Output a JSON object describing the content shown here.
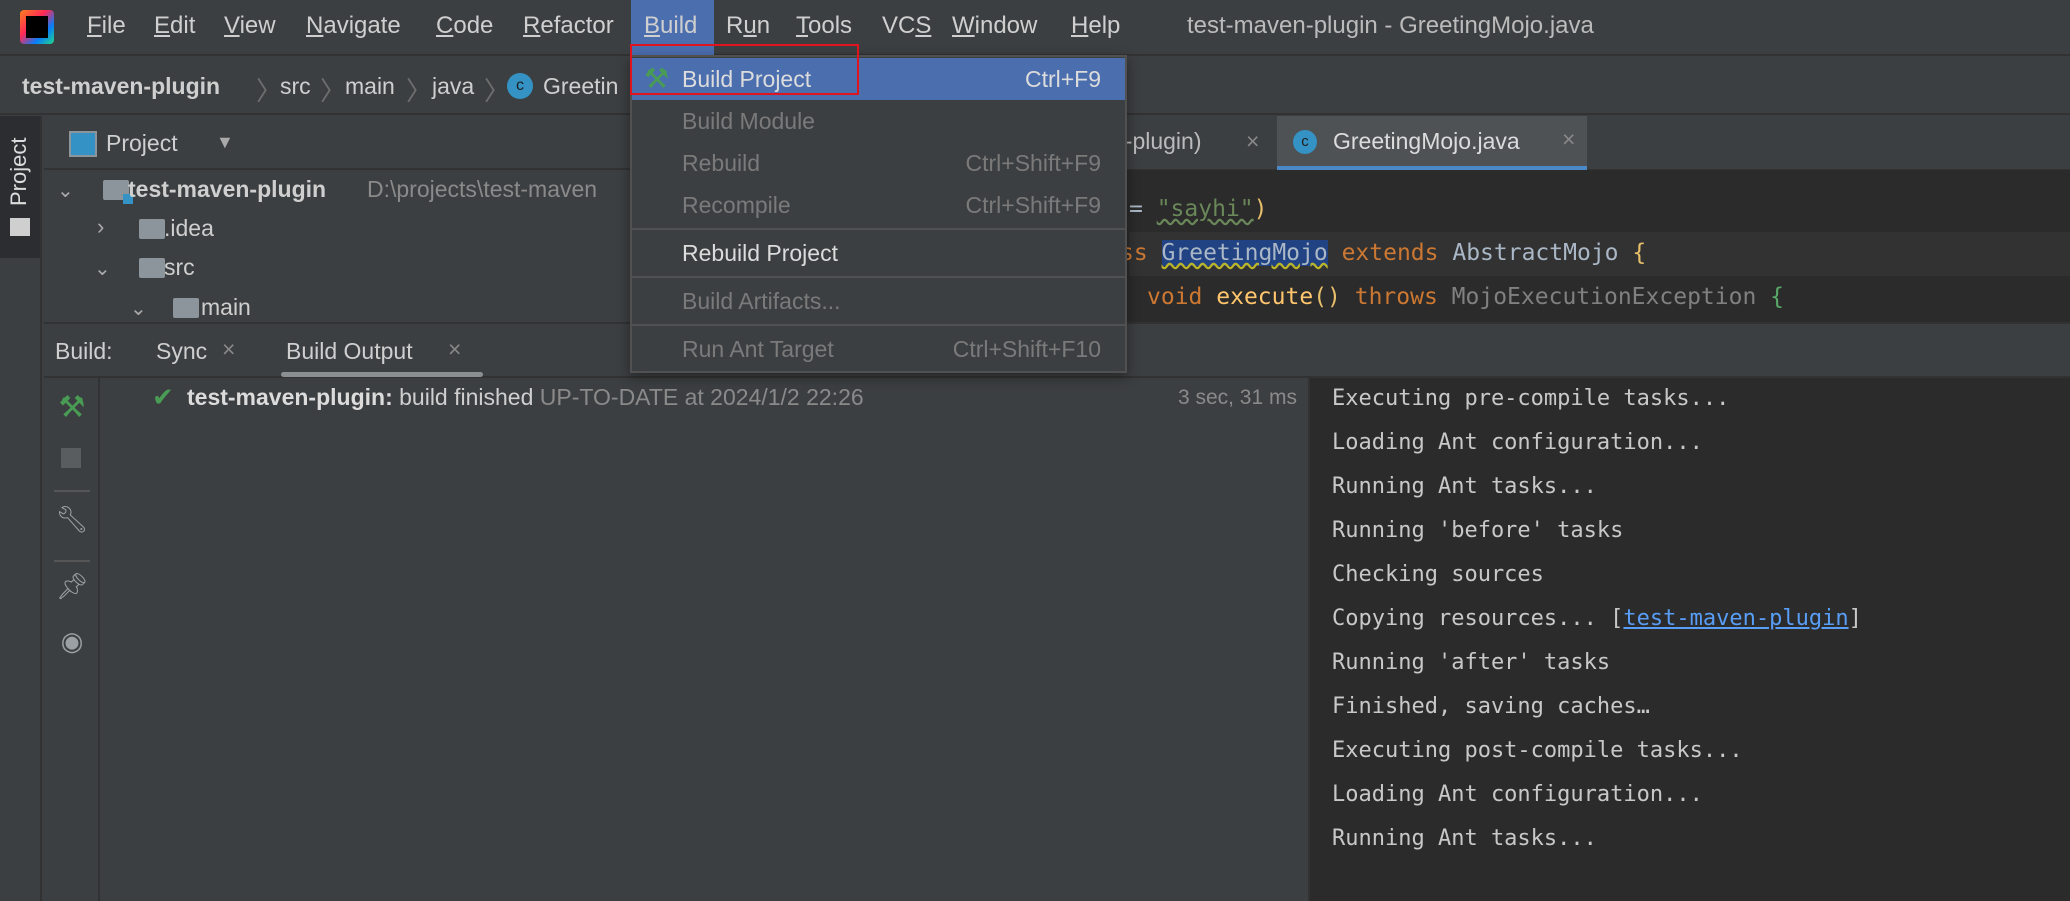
{
  "window": {
    "title": "test-maven-plugin - GreetingMojo.java",
    "logo": "intellij-idea-logo"
  },
  "menubar": {
    "items": [
      {
        "label": "File",
        "mnemonic": "F"
      },
      {
        "label": "Edit",
        "mnemonic": "E"
      },
      {
        "label": "View",
        "mnemonic": "V"
      },
      {
        "label": "Navigate",
        "mnemonic": "N"
      },
      {
        "label": "Code",
        "mnemonic": "C"
      },
      {
        "label": "Refactor",
        "mnemonic": "R"
      },
      {
        "label": "Build",
        "mnemonic": "B",
        "active": true
      },
      {
        "label": "Run",
        "mnemonic": "u"
      },
      {
        "label": "Tools",
        "mnemonic": "T"
      },
      {
        "label": "VCS",
        "mnemonic": "S"
      },
      {
        "label": "Window",
        "mnemonic": "W"
      },
      {
        "label": "Help",
        "mnemonic": "H"
      }
    ]
  },
  "breadcrumb": [
    "test-maven-plugin",
    "src",
    "main",
    "java",
    "Greetin"
  ],
  "project_panel": {
    "title": "Project",
    "side_tab": "Project",
    "tree": [
      {
        "name": "test-maven-plugin",
        "path": "D:\\projects\\test-maven",
        "expanded": true
      },
      {
        "name": ".idea",
        "expanded": false
      },
      {
        "name": "src",
        "expanded": true
      },
      {
        "name": "main",
        "expanded": true
      }
    ]
  },
  "editor": {
    "tabs": [
      {
        "label": "n-plugin)",
        "active": false
      },
      {
        "label": "GreetingMojo.java",
        "active": true
      }
    ],
    "lines": [
      {
        "l1a": "= ",
        "l1b": "\"sayhi\"",
        "l1c": ")"
      },
      {
        "kw1": "ss ",
        "cls": "GreetingMojo",
        "kw2": " extends ",
        "sup": "AbstractMojo",
        "br": " {"
      },
      {
        "kw1": "void ",
        "fn": "execute",
        "p": "()",
        "kw2": " throws ",
        "ex": "MojoExecutionException",
        "br": " {"
      }
    ]
  },
  "build_menu": {
    "items": [
      {
        "label": "Build Project",
        "shortcut": "Ctrl+F9",
        "enabled": true,
        "highlighted": true,
        "icon": "hammer-icon"
      },
      {
        "label": "Build Module",
        "shortcut": "",
        "enabled": false
      },
      {
        "label": "Rebuild",
        "shortcut": "Ctrl+Shift+F9",
        "enabled": false
      },
      {
        "label": "Recompile",
        "shortcut": "Ctrl+Shift+F9",
        "enabled": false
      },
      {
        "label": "Rebuild Project",
        "shortcut": "",
        "enabled": true
      },
      {
        "label": "Build Artifacts...",
        "shortcut": "",
        "enabled": false
      },
      {
        "label": "Run Ant Target",
        "shortcut": "Ctrl+Shift+F10",
        "enabled": false
      }
    ]
  },
  "build_panel": {
    "label": "Build:",
    "tabs": [
      {
        "label": "Sync"
      },
      {
        "label": "Build Output",
        "active": true
      }
    ],
    "result": {
      "project": "test-maven-plugin:",
      "status": "build finished",
      "detail": "UP-TO-DATE at 2024/1/2 22:26",
      "duration": "3 sec, 31 ms"
    },
    "console": {
      "lines": [
        "Executing pre-compile tasks...",
        "Loading Ant configuration...",
        "Running Ant tasks...",
        "Running 'before' tasks",
        "Checking sources"
      ],
      "copy_prefix": "Copying resources... [",
      "copy_link": "test-maven-plugin",
      "copy_suffix": "]",
      "lines2": [
        "Running 'after' tasks",
        "Finished, saving caches…",
        "Executing post-compile tasks...",
        "Loading Ant configuration...",
        "Running Ant tasks..."
      ]
    }
  },
  "colors": {
    "accent": "#4b6eaf",
    "highlight_box": "#e0141e",
    "success": "#499c54",
    "link": "#589df6",
    "keyword": "#cc7832",
    "string": "#6a8759"
  }
}
